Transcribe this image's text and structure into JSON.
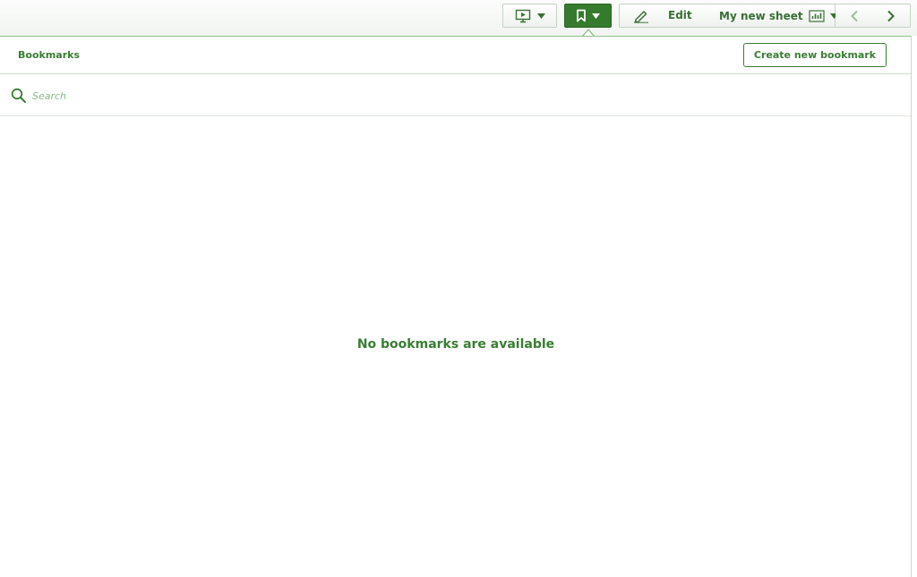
{
  "toolbar": {
    "present_icon": "presentation-play-icon",
    "bookmark_icon": "bookmark-icon",
    "edit_label": "Edit",
    "edit_icon": "pencil-icon",
    "sheet_label": "My new sheet",
    "sheet_icon": "sheet-chart-icon",
    "prev_icon": "chevron-left-icon",
    "next_icon": "chevron-right-icon",
    "accent": "#367a2e"
  },
  "panel": {
    "title": "Bookmarks",
    "create_label": "Create new bookmark",
    "search_placeholder": "Search",
    "search_value": "",
    "empty_message": "No bookmarks are available"
  }
}
